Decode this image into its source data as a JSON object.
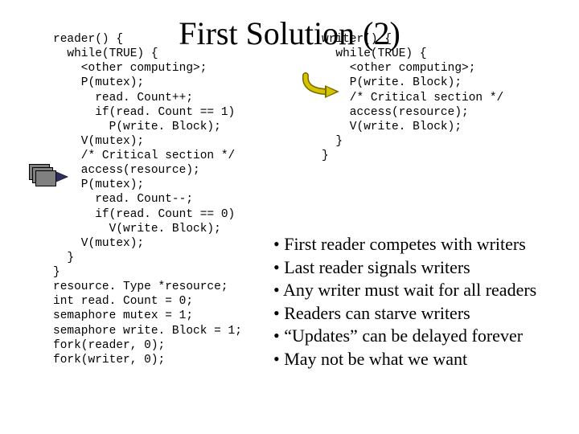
{
  "title": "First Solution (2)",
  "reader_code": "reader() {\n  while(TRUE) {\n    <other computing>;\n    P(mutex);\n      read. Count++;\n      if(read. Count == 1)\n        P(write. Block);\n    V(mutex);\n    /* Critical section */\n    access(resource);\n    P(mutex);\n      read. Count--;\n      if(read. Count == 0)\n        V(write. Block);\n    V(mutex);\n  }\n}\nresource. Type *resource;\nint read. Count = 0;\nsemaphore mutex = 1;\nsemaphore write. Block = 1;\nfork(reader, 0);\nfork(writer, 0);",
  "writer_code": "writer() {\n  while(TRUE) {\n    <other computing>;\n    P(write. Block);\n    /* Critical section */\n    access(resource);\n    V(write. Block);\n  }\n}",
  "bullets_text": "• First reader competes with writers\n• Last reader signals writers\n• Any writer must wait for all readers\n• Readers can starve writers\n• “Updates” can be delayed forever\n• May not be what we want"
}
